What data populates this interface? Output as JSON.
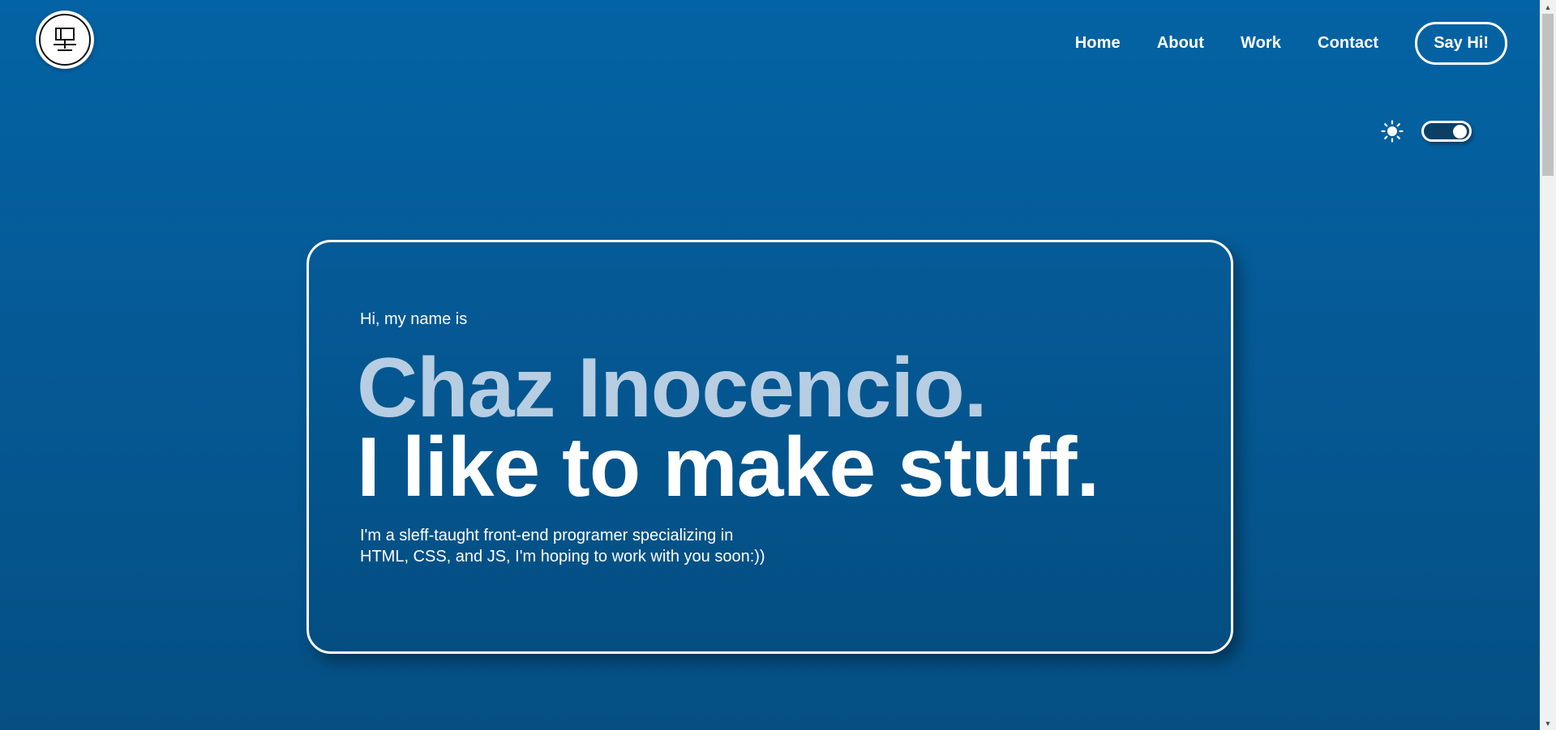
{
  "header": {
    "logo": {
      "icon": "logo-monogram-icon"
    },
    "nav": {
      "items": [
        {
          "label": "Home"
        },
        {
          "label": "About"
        },
        {
          "label": "Work"
        },
        {
          "label": "Contact"
        }
      ],
      "cta_label": "Say Hi!"
    }
  },
  "theme_toggle": {
    "light_icon": "sun-icon",
    "dark_icon": "moon-icon",
    "state": "dark"
  },
  "hero": {
    "intro": "Hi, my name is",
    "name": "Chaz Inocencio.",
    "tagline": "I like to make stuff.",
    "description": "I'm a sleff-taught front-end programer specializing in HTML, CSS, and JS, I'm hoping to work with you soon:))"
  },
  "colors": {
    "background": "#0463a4",
    "name_text": "#b7cde2",
    "text": "#ffffff"
  }
}
